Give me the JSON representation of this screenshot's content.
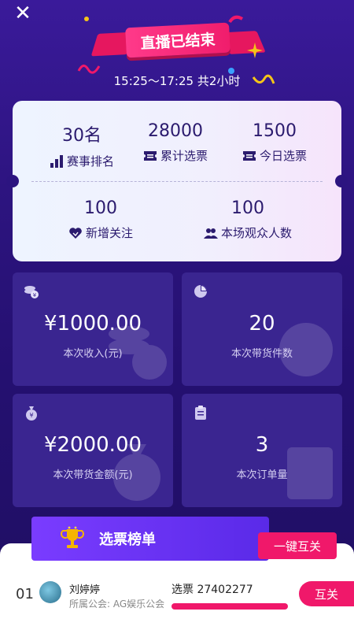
{
  "header": {
    "close_glyph": "✕",
    "banner_title": "直播已结束",
    "time_range": "15:25～17:25 共2小时"
  },
  "stats": [
    {
      "value": "30名",
      "label": "赛事排名",
      "icon": "bar-chart-icon"
    },
    {
      "value": "28000",
      "label": "累计选票",
      "icon": "ticket-icon"
    },
    {
      "value": "1500",
      "label": "今日选票",
      "icon": "ticket-icon"
    },
    {
      "value": "100",
      "label": "新增关注",
      "icon": "heart-icon"
    },
    {
      "value": "100",
      "label": "本场观众人数",
      "icon": "people-icon"
    }
  ],
  "tiles": [
    {
      "value": "¥1000.00",
      "label": "本次收入(元)",
      "icon": "coins-icon"
    },
    {
      "value": "20",
      "label": "本次带货件数",
      "icon": "pie-icon"
    },
    {
      "value": "¥2000.00",
      "label": "本次带货金额(元)",
      "icon": "money-bag-icon"
    },
    {
      "value": "3",
      "label": "本次订单量",
      "icon": "clipboard-icon"
    }
  ],
  "ranking": {
    "tab_label": "选票榜单",
    "follow_all_label": "一键互关",
    "rows": [
      {
        "index": "01",
        "name": "刘婷婷",
        "guild": "所属公会: AG娱乐公会",
        "votes": "选票 27402277",
        "follow_label": "互关"
      }
    ]
  },
  "colors": {
    "accent_pink": "#f0186a",
    "bg_purple": "#2d1480",
    "tile_purple": "#3a2590",
    "text_dark": "#2b1b6e"
  }
}
